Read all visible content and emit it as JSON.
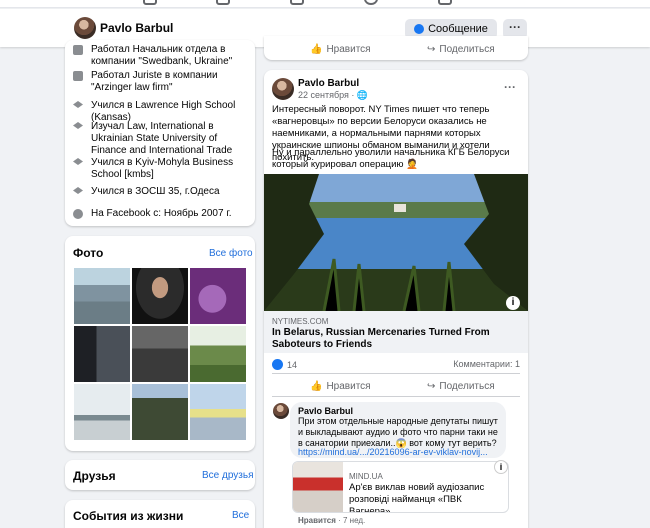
{
  "header": {
    "name": "Pavlo Barbul",
    "message_button": "Сообщение",
    "more_button": "···"
  },
  "intro": {
    "items": [
      {
        "icon": "briefcase-icon",
        "text": "Работал Начальник отдела в компании \"Swedbank, Ukraine\""
      },
      {
        "icon": "briefcase-icon",
        "text": "Работал Juriste в компании \"Arzinger law firm\""
      },
      {
        "icon": "graduation-cap-icon",
        "text": "Учился в Lawrence High School (Kansas)"
      },
      {
        "icon": "graduation-cap-icon",
        "text": "Изучал Law, International в Ukrainian State University of Finance and International Trade"
      },
      {
        "icon": "graduation-cap-icon",
        "text": "Учился в Kyiv-Mohyla Business School [kmbs]"
      },
      {
        "icon": "graduation-cap-icon",
        "text": "Учился в ЗОСШ 35, г.Одеса"
      },
      {
        "icon": "clock-icon",
        "text": "На Facebook с: Ноябрь 2007 г."
      }
    ]
  },
  "photos": {
    "title": "Фото",
    "link": "Все фото"
  },
  "friends": {
    "title": "Друзья",
    "link": "Все друзья"
  },
  "life_events": {
    "title": "События из жизни",
    "link": "Все"
  },
  "prev_post": {
    "like": "Нравится",
    "share": "Поделиться"
  },
  "post": {
    "author": "Pavlo Barbul",
    "date": "22 сентября · ",
    "text1": "Интересный поворот. NY Times пишет что теперь «вагнеровцы» по версии Белоруси оказались не наемниками, а нормальными парнями которых украинские шпионы обманом выманили и хотели похитить.",
    "text2": "Ну и параллельно уволили начальника КГБ Белоруси который курировал операцию 🤦",
    "link_domain": "NYTIMES.COM",
    "link_title": "In Belarus, Russian Mercenaries Turned From Saboteurs to Friends",
    "reactions_count": "14",
    "comments_count": "Комментарии: 1",
    "like": "Нравится",
    "share": "Поделиться",
    "colors": {
      "accent": "#1877f2",
      "link": "#216fdb"
    }
  },
  "comment": {
    "author": "Pavlo Barbul",
    "text": "При этом отдельные народные депутаты пишут и выкладывают аудио и фото что парни таки не в санатории приехали..😱 вот кому тут верить?",
    "link": "https://mind.ua/.../20216096-ar-ev-viklav-novij...",
    "preview_domain": "MIND.UA",
    "preview_title": "Ар'єв виклав новий аудіозапис розповіді найманця «ПВК Вагнера»",
    "like": "Нравится",
    "time": "· 7 нед."
  }
}
